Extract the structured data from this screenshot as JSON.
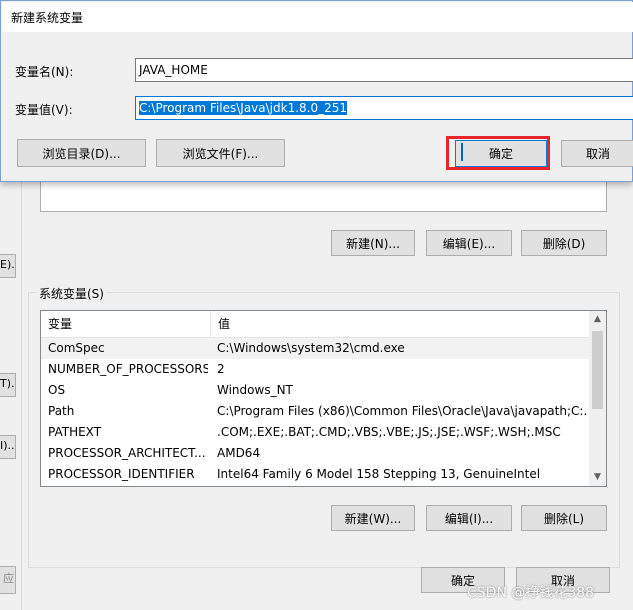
{
  "new_var_dialog": {
    "title": "新建系统变量",
    "name_label": "变量名(N):",
    "name_value": "JAVA_HOME",
    "value_label": "变量值(V):",
    "value_value": "C:\\Program Files\\Java\\jdk1.8.0_251",
    "browse_dir_button": "浏览目录(D)...",
    "browse_file_button": "浏览文件(F)...",
    "ok_button": "确定",
    "cancel_button": "取消"
  },
  "user_vars_buttons": {
    "new": "新建(N)...",
    "edit": "编辑(E)...",
    "delete": "删除(D)"
  },
  "left_stubs": [
    "E)...",
    "T)...",
    "I)...",
    "应"
  ],
  "system_vars": {
    "group_label": "系统变量(S)",
    "columns": [
      "变量",
      "值"
    ],
    "rows": [
      {
        "name": "ComSpec",
        "value": "C:\\Windows\\system32\\cmd.exe"
      },
      {
        "name": "NUMBER_OF_PROCESSORS",
        "value": "2"
      },
      {
        "name": "OS",
        "value": "Windows_NT"
      },
      {
        "name": "Path",
        "value": "C:\\Program Files (x86)\\Common Files\\Oracle\\Java\\javapath;C:..."
      },
      {
        "name": "PATHEXT",
        "value": ".COM;.EXE;.BAT;.CMD;.VBS;.VBE;.JS;.JSE;.WSF;.WSH;.MSC"
      },
      {
        "name": "PROCESSOR_ARCHITECT...",
        "value": "AMD64"
      },
      {
        "name": "PROCESSOR_IDENTIFIER",
        "value": "Intel64 Family 6 Model 158 Stepping 13, GenuineIntel"
      }
    ],
    "new_button": "新建(W)...",
    "edit_button": "编辑(I)...",
    "delete_button": "删除(L)"
  },
  "footer": {
    "ok_button": "确定",
    "cancel_button": "取消"
  },
  "watermark": "CSDN @挣钱花388",
  "colors": {
    "selection": "#0078d7",
    "highlight": "#e8262c"
  }
}
